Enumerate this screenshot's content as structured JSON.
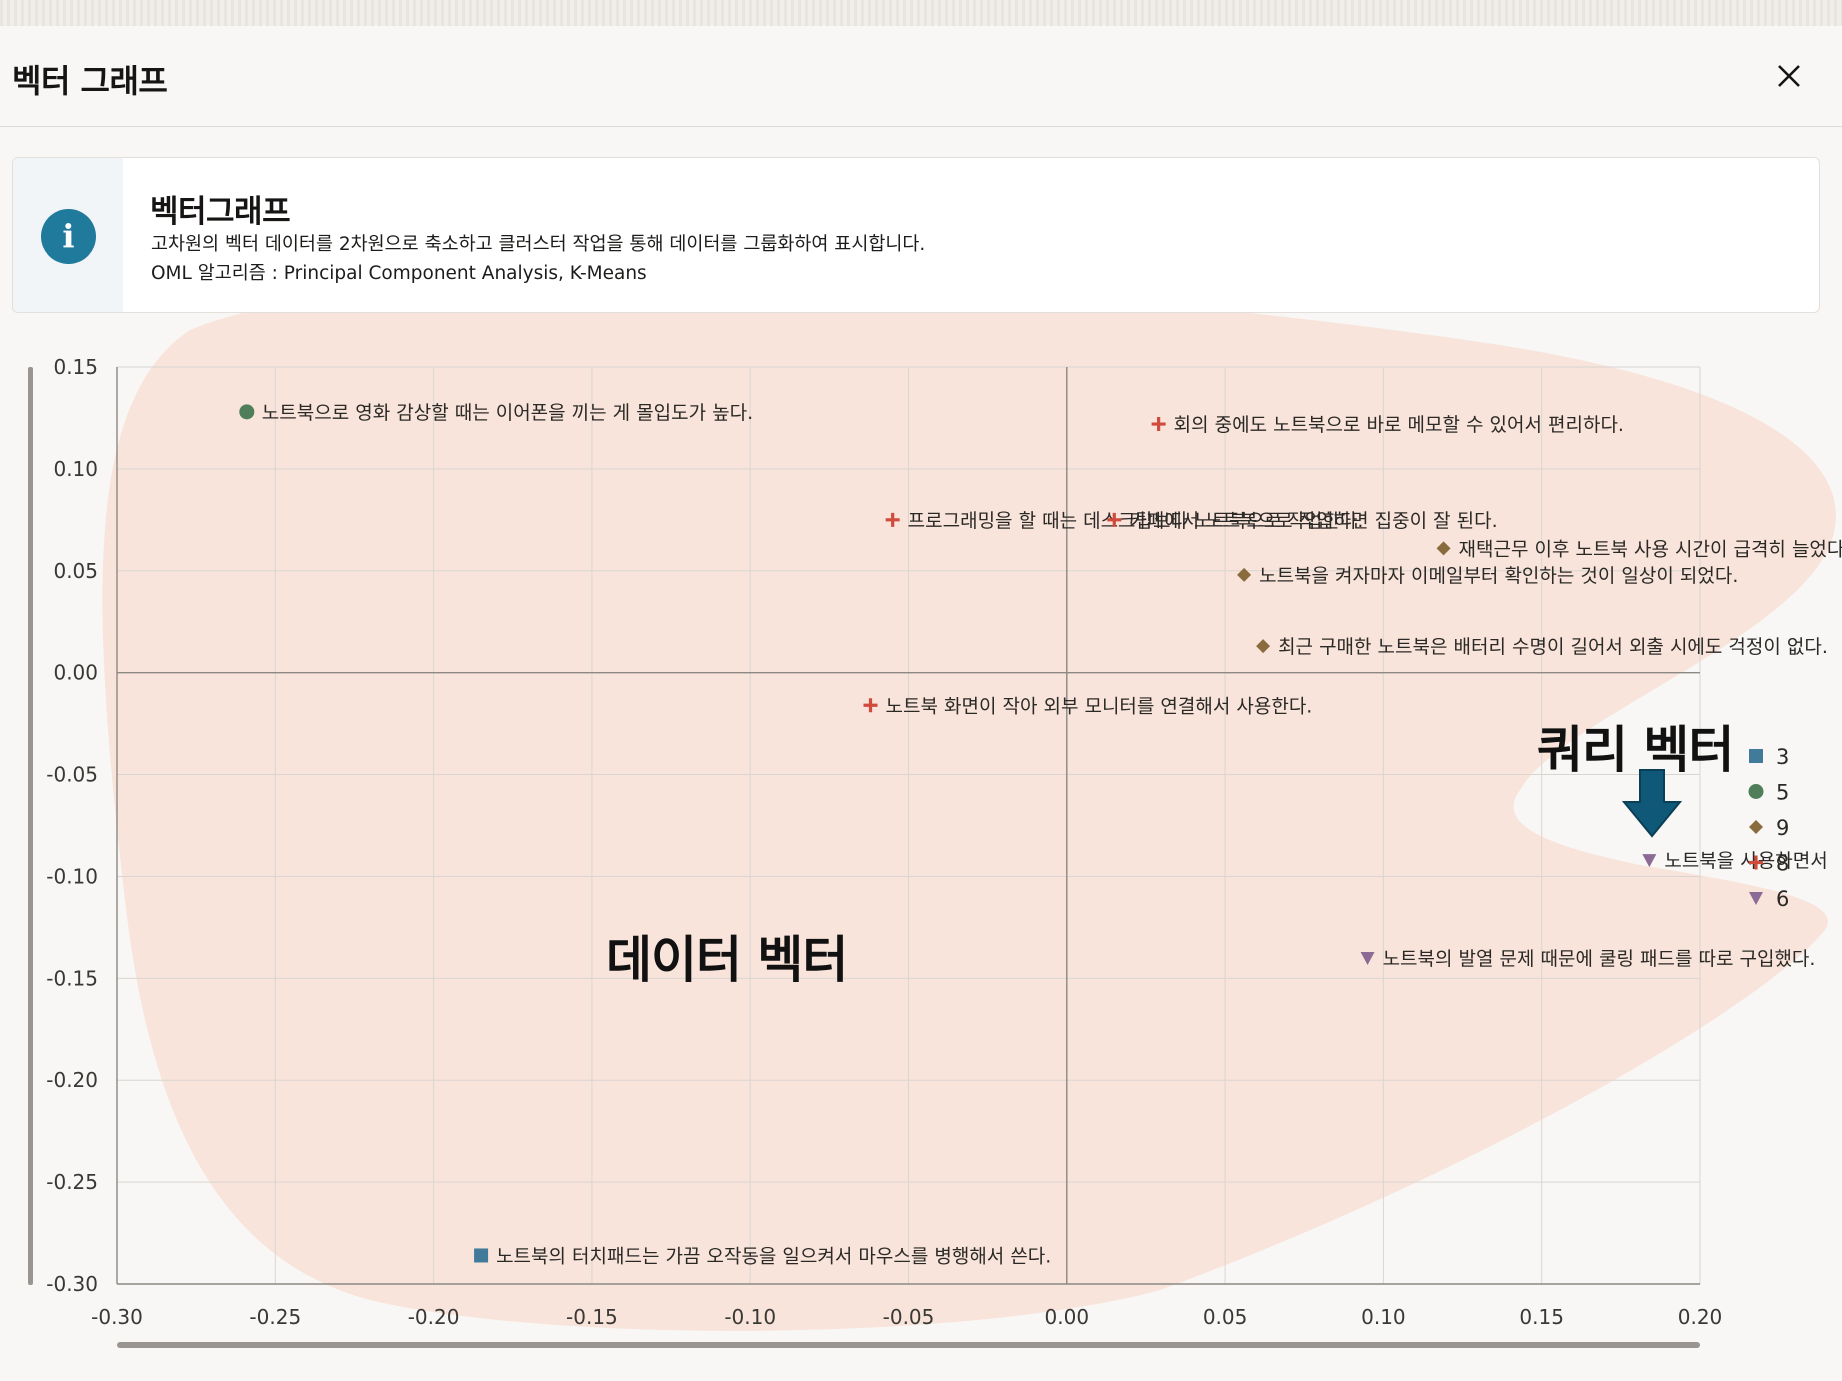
{
  "dialog": {
    "title": "벡터 그래프",
    "close_icon": "close-icon"
  },
  "banner": {
    "icon": "info-icon",
    "icon_glyph": "i",
    "title": "벡터그래프",
    "description": "고차원의 벡터 데이터를 2차원으로 축소하고 클러스터 작업을 통해 데이터를 그룹화하여 표시합니다.",
    "algorithms": "OML 알고리즘 : Principal Component Analysis, K-Means"
  },
  "annotations": {
    "data_vector": "데이터 벡터",
    "query_vector": "쿼리 벡터",
    "arrow_icon": "arrow-down-icon"
  },
  "colors": {
    "highlight_blob": "#f8e0d5",
    "info_icon": "#1f7a9c",
    "arrow": "#0f5878",
    "cluster_3": "#427b99",
    "cluster_5": "#4f7f5a",
    "cluster_9": "#8a6b3e",
    "cluster_8": "#d04b3b",
    "cluster_6": "#8b6b96"
  },
  "chart_data": {
    "type": "scatter",
    "xlim": [
      -0.3,
      0.2
    ],
    "ylim": [
      -0.3,
      0.15
    ],
    "x_ticks": [
      "-0.30",
      "-0.25",
      "-0.20",
      "-0.15",
      "-0.10",
      "-0.05",
      "0.00",
      "0.05",
      "0.10",
      "0.15",
      "0.20"
    ],
    "y_ticks": [
      "0.15",
      "0.10",
      "0.05",
      "0.00",
      "-0.05",
      "-0.10",
      "-0.15",
      "-0.20",
      "-0.25",
      "-0.30"
    ],
    "grid": true,
    "legend_position": "right",
    "legend": [
      {
        "label": "3",
        "marker": "square",
        "color": "#427b99"
      },
      {
        "label": "5",
        "marker": "circle",
        "color": "#4f7f5a"
      },
      {
        "label": "9",
        "marker": "diamond",
        "color": "#8a6b3e"
      },
      {
        "label": "8",
        "marker": "plus",
        "color": "#d04b3b"
      },
      {
        "label": "6",
        "marker": "triangle-down",
        "color": "#8b6b96"
      }
    ],
    "points": [
      {
        "x": -0.259,
        "y": 0.128,
        "cluster": "5",
        "label": "노트북으로 영화 감상할 때는 이어폰을 끼는 게 몰입도가 높다."
      },
      {
        "x": 0.029,
        "y": 0.122,
        "cluster": "8",
        "label": "회의 중에도 노트북으로 바로 메모할 수 있어서 편리하다."
      },
      {
        "x": -0.055,
        "y": 0.075,
        "cluster": "8",
        "label": "프로그래밍을 할 때는 데스크탑보다 노트북으로 작업한다."
      },
      {
        "x": 0.015,
        "y": 0.075,
        "cluster": "8",
        "label": "카페에서 노트북으로 작업하면 집중이 잘 된다."
      },
      {
        "x": 0.119,
        "y": 0.061,
        "cluster": "9",
        "label": "재택근무 이후 노트북 사용 시간이 급격히 늘었다."
      },
      {
        "x": 0.056,
        "y": 0.048,
        "cluster": "9",
        "label": "노트북을 켜자마자 이메일부터 확인하는 것이 일상이 되었다."
      },
      {
        "x": 0.062,
        "y": 0.013,
        "cluster": "9",
        "label": "최근 구매한 노트북은 배터리 수명이 길어서 외출 시에도 걱정이 없다."
      },
      {
        "x": -0.062,
        "y": -0.016,
        "cluster": "8",
        "label": "노트북 화면이 작아 외부 모니터를 연결해서 사용한다."
      },
      {
        "x": 0.184,
        "y": -0.092,
        "cluster": "6",
        "label": "노트북을 사용하면서"
      },
      {
        "x": 0.095,
        "y": -0.14,
        "cluster": "6",
        "label": "노트북의 발열 문제 때문에 쿨링 패드를 따로 구입했다."
      },
      {
        "x": -0.185,
        "y": -0.286,
        "cluster": "3",
        "label": "노트북의 터치패드는 가끔 오작동을 일으켜서 마우스를 병행해서 쓴다."
      }
    ]
  }
}
